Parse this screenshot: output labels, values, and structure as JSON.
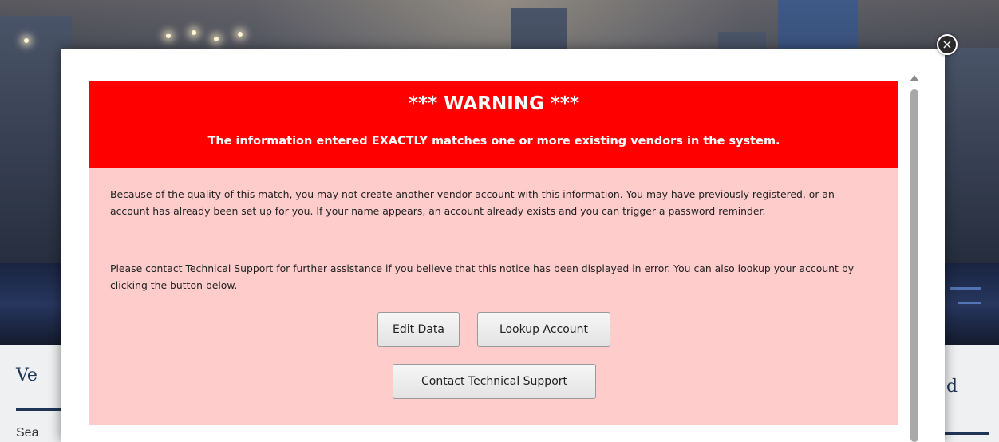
{
  "background": {
    "section_left_title": "Ve",
    "section_left_text": "Sea",
    "section_right_title": "d"
  },
  "modal": {
    "close_icon": "×",
    "warning": {
      "title": "*** WARNING ***",
      "subtitle": "The information entered EXACTLY matches one or more existing vendors in the system."
    },
    "body": {
      "paragraph_1": "Because of the quality of this match, you may not create another vendor account with this information. You may have previously registered, or an account has already been set up for you. If your name appears, an account already exists and you can trigger a password reminder.",
      "paragraph_2": "Please contact Technical Support for further assistance if you believe that this notice has been displayed in error. You can also lookup your account by clicking the button below."
    },
    "buttons": {
      "edit_data": "Edit Data",
      "lookup_account": "Lookup Account",
      "contact_support": "Contact Technical Support"
    }
  },
  "colors": {
    "warning_header": "#ff0000",
    "warning_body": "#ffcccc",
    "heading_navy": "#1f3556"
  }
}
